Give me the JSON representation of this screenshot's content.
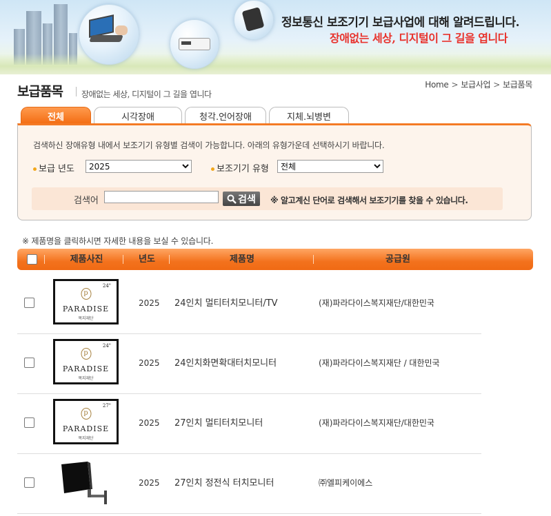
{
  "banner": {
    "title": "정보통신 보조기기 보급사업에 대해 알려드립니다.",
    "subtitle": "장애없는 세상, 디지털이 그 길을 엽니다"
  },
  "page": {
    "title": "보급품목",
    "subtitle": "장애없는 세상, 디지털이 그 길을 엽니다"
  },
  "breadcrumb": [
    "Home",
    "보급사업",
    "보급품목"
  ],
  "tabs": [
    {
      "label": "전체",
      "active": true
    },
    {
      "label": "시각장애",
      "active": false
    },
    {
      "label": "청각.언어장애",
      "active": false
    },
    {
      "label": "지체.뇌병변",
      "active": false
    }
  ],
  "search": {
    "description": "검색하신 장애유형 내에서 보조기기 유형별 검색이 가능합니다. 아래의 유형가운데 선택하시기 바랍니다.",
    "year_label": "보급 년도",
    "year_value": "2025",
    "type_label": "보조기기 유형",
    "type_value": "전체",
    "keyword_label": "검색어",
    "keyword_value": "",
    "button_label": "검색",
    "note": "※ 알고계신 단어로 검색해서 보조기기를 찾을 수 있습니다."
  },
  "notice": "※ 제품명을 클릭하시면 자세한 내용을 보실 수 있습니다.",
  "table": {
    "headers": {
      "photo": "제품사진",
      "year": "년도",
      "name": "제품명",
      "supplier": "공급원"
    },
    "rows": [
      {
        "year": "2025",
        "name": "24인치 멀티터치모니터/TV",
        "supplier": "(재)파라다이스복지재단/대한민국",
        "thumb": {
          "kind": "paradise",
          "size": "24\"",
          "brand": "PARADISE",
          "sub": "복지재단"
        }
      },
      {
        "year": "2025",
        "name": "24인치화면확대터치모니터",
        "supplier": "(재)파라다이스복지재단 / 대한민국",
        "thumb": {
          "kind": "paradise",
          "size": "24\"",
          "brand": "PARADISE",
          "sub": "복지재단"
        }
      },
      {
        "year": "2025",
        "name": "27인치 멀티터치모니터",
        "supplier": "(재)파라다이스복지재단/대한민국",
        "thumb": {
          "kind": "paradise",
          "size": "27\"",
          "brand": "PARADISE",
          "sub": "복지재단"
        }
      },
      {
        "year": "2025",
        "name": "27인치 정전식 터치모니터",
        "supplier": "㈜엘피케이에스",
        "thumb": {
          "kind": "monitor-arm"
        }
      }
    ]
  },
  "colors": {
    "accent": "#f3721d",
    "tab_active": "#f36c12",
    "banner_red": "#e8322c"
  }
}
